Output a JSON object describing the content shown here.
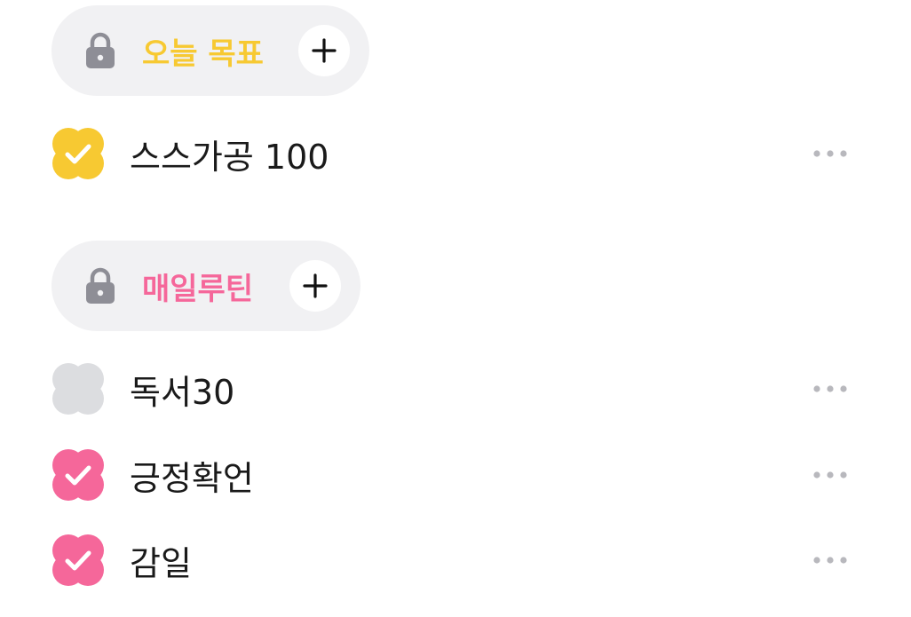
{
  "categories": [
    {
      "label": "오늘 목표",
      "color": "#f7c932",
      "add_symbol": "+",
      "todos": [
        {
          "text": "스스가공 100",
          "done": true
        }
      ]
    },
    {
      "label": "매일루틴",
      "color": "#f5679a",
      "add_symbol": "+",
      "todos": [
        {
          "text": "독서30",
          "done": false
        },
        {
          "text": "긍정확언",
          "done": true
        },
        {
          "text": "감일",
          "done": true
        }
      ]
    }
  ],
  "colors": {
    "chip_background": "#f1f1f3",
    "lock_gray": "#8e8e96",
    "unchecked_gray": "#dcdde0",
    "dots_gray": "#b8b8bd"
  },
  "icons": {
    "lock": "lock-icon",
    "check": "check-icon",
    "more": "more-horizontal-icon"
  }
}
